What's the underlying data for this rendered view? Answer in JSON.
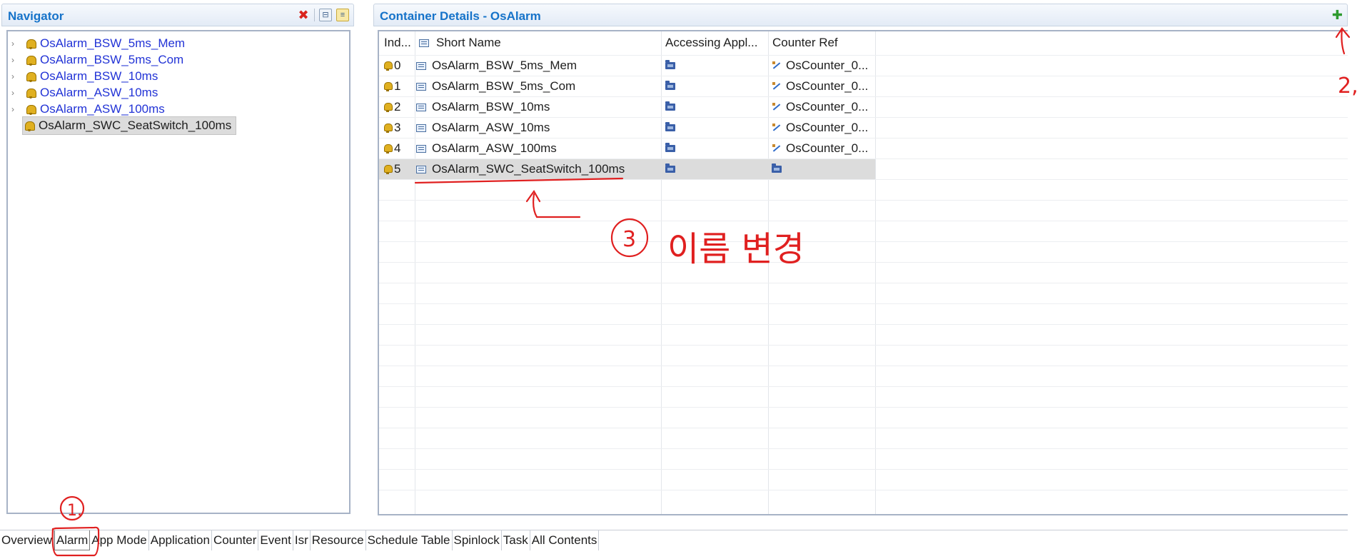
{
  "navigator": {
    "title": "Navigator",
    "items": [
      {
        "label": "OsAlarm_BSW_5ms_Mem",
        "expandable": true
      },
      {
        "label": "OsAlarm_BSW_5ms_Com",
        "expandable": true
      },
      {
        "label": "OsAlarm_BSW_10ms",
        "expandable": true
      },
      {
        "label": "OsAlarm_ASW_10ms",
        "expandable": true
      },
      {
        "label": "OsAlarm_ASW_100ms",
        "expandable": true
      },
      {
        "label": "OsAlarm_SWC_SeatSwitch_100ms",
        "expandable": false,
        "selected": true
      }
    ]
  },
  "details": {
    "title": "Container Details - OsAlarm",
    "columns": [
      "Ind...",
      "Short Name",
      "Accessing Appl...",
      "Counter Ref"
    ],
    "rows": [
      {
        "index": "0",
        "short_name": "OsAlarm_BSW_5ms_Mem",
        "counter_ref": "OsCounter_0..."
      },
      {
        "index": "1",
        "short_name": "OsAlarm_BSW_5ms_Com",
        "counter_ref": "OsCounter_0..."
      },
      {
        "index": "2",
        "short_name": "OsAlarm_BSW_10ms",
        "counter_ref": "OsCounter_0..."
      },
      {
        "index": "3",
        "short_name": "OsAlarm_ASW_10ms",
        "counter_ref": "OsCounter_0..."
      },
      {
        "index": "4",
        "short_name": "OsAlarm_ASW_100ms",
        "counter_ref": "OsCounter_0..."
      },
      {
        "index": "5",
        "short_name": "OsAlarm_SWC_SeatSwitch_100ms",
        "counter_ref": "",
        "selected": true
      }
    ]
  },
  "tabs": [
    "Overview",
    "Alarm",
    "App Mode",
    "Application",
    "Counter",
    "Event",
    "Isr",
    "Resource",
    "Schedule Table",
    "Spinlock",
    "Task",
    "All Contents"
  ],
  "active_tab": "Alarm",
  "annotations": {
    "color": "#e02020",
    "marker_1": "1.",
    "marker_2": "2,",
    "marker_3": "3",
    "note_3": "이름 변경"
  }
}
